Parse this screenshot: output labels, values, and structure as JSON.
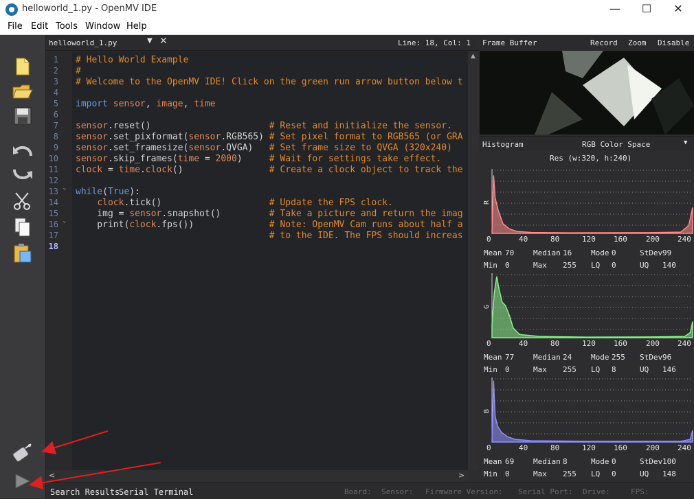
{
  "window": {
    "title": "helloworld_1.py - OpenMV IDE",
    "minimize": "—",
    "maximize": "☐",
    "close": "✕"
  },
  "menu": [
    "File",
    "Edit",
    "Tools",
    "Window",
    "Help"
  ],
  "editor": {
    "filename": "helloworld_1.py",
    "position": "Line: 18, Col: 1",
    "line_numbers": [
      "1",
      "2",
      "3",
      "4",
      "5",
      "6",
      "7",
      "8",
      "9",
      "10",
      "11",
      "12",
      "13",
      "14",
      "15",
      "16",
      "17",
      "18"
    ],
    "lines": [
      "# Hello World Example",
      "#",
      "# Welcome to the OpenMV IDE! Click on the green run arrow button below t",
      "",
      "import sensor, image, time",
      "",
      "sensor.reset()                      # Reset and initialize the sensor.",
      "sensor.set_pixformat(sensor.RGB565) # Set pixel format to RGB565 (or GRA",
      "sensor.set_framesize(sensor.QVGA)   # Set frame size to QVGA (320x240)",
      "sensor.skip_frames(time = 2000)     # Wait for settings take effect.",
      "clock = time.clock()                # Create a clock object to track the",
      "",
      "while(True):",
      "    clock.tick()                    # Update the FPS clock.",
      "    img = sensor.snapshot()         # Take a picture and return the imag",
      "    print(clock.fps())              # Note: OpenMV Cam runs about half a",
      "                                    # to the IDE. The FPS should increas",
      ""
    ]
  },
  "framebuffer": {
    "title": "Frame Buffer",
    "record": "Record",
    "zoom": "Zoom",
    "disable": "Disable"
  },
  "histogram": {
    "title": "Histogram",
    "colorspace": "RGB Color Space",
    "resolution": "Res (w:320, h:240)",
    "ticks": [
      "0",
      "40",
      "80",
      "120",
      "160",
      "200",
      "240"
    ],
    "channels": [
      {
        "label": "R",
        "color": "#ff8a8a",
        "stats": [
          [
            "Mean",
            "70"
          ],
          [
            "Median",
            "16"
          ],
          [
            "Mode",
            "0"
          ],
          [
            "StDev",
            "99"
          ]
        ],
        "stats2": [
          [
            "Min",
            "0"
          ],
          [
            "Max",
            "255"
          ],
          [
            "LQ",
            "0"
          ],
          [
            "UQ",
            "140"
          ]
        ]
      },
      {
        "label": "G",
        "color": "#8cf08c",
        "stats": [
          [
            "Mean",
            "77"
          ],
          [
            "Median",
            "24"
          ],
          [
            "Mode",
            "255"
          ],
          [
            "StDev",
            "96"
          ]
        ],
        "stats2": [
          [
            "Min",
            "0"
          ],
          [
            "Max",
            "255"
          ],
          [
            "LQ",
            "8"
          ],
          [
            "UQ",
            "146"
          ]
        ]
      },
      {
        "label": "B",
        "color": "#8f8fff",
        "stats": [
          [
            "Mean",
            "69"
          ],
          [
            "Median",
            "8"
          ],
          [
            "Mode",
            "0"
          ],
          [
            "StDev",
            "100"
          ]
        ],
        "stats2": [
          [
            "Min",
            "0"
          ],
          [
            "Max",
            "255"
          ],
          [
            "LQ",
            "0"
          ],
          [
            "UQ",
            "148"
          ]
        ]
      }
    ]
  },
  "bottom": {
    "search_results": "Search Results",
    "serial_terminal": "Serial Terminal",
    "status": [
      "Board:",
      "Sensor:",
      "Firmware Version:",
      "Serial Port:",
      "Drive:",
      "FPS:"
    ]
  },
  "colors": {
    "accent": "#e28a2b",
    "keyword": "#6d9bd8",
    "annotation_arrow": "#e02020"
  }
}
